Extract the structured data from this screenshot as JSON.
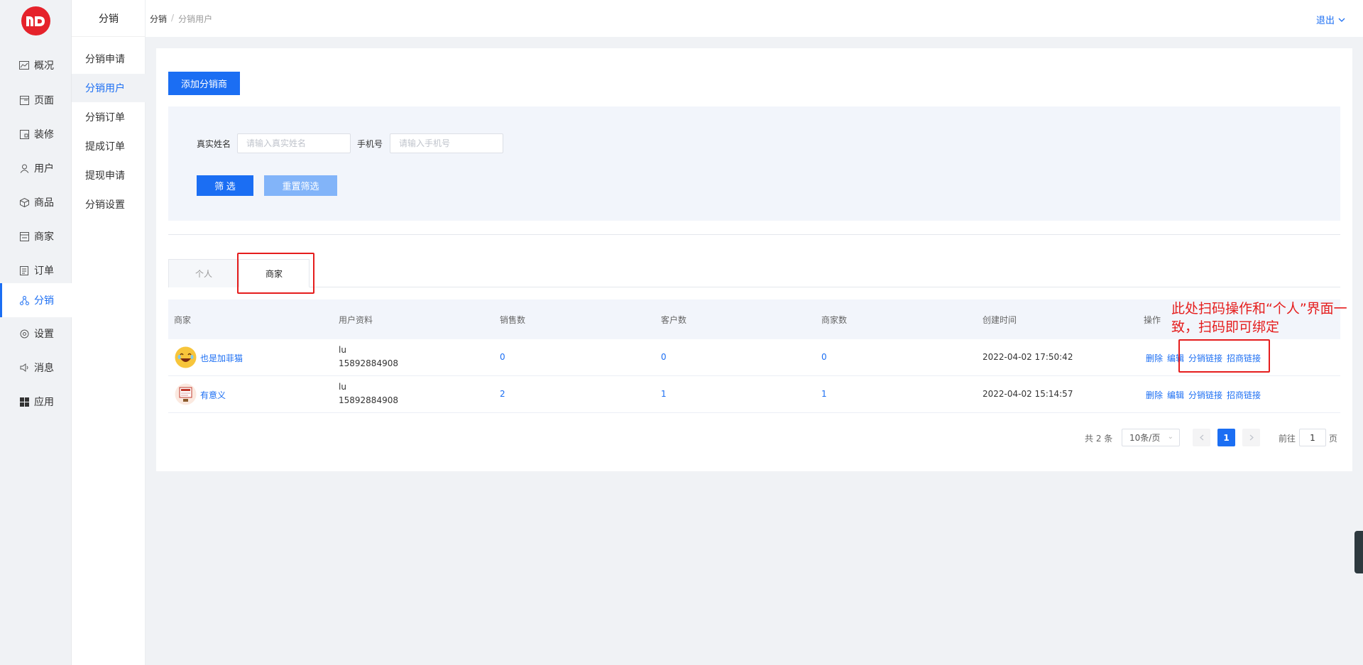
{
  "rail": {
    "items": [
      {
        "label": "概况",
        "icon": "line-chart-icon"
      },
      {
        "label": "页面",
        "icon": "page-icon"
      },
      {
        "label": "装修",
        "icon": "decorate-icon"
      },
      {
        "label": "用户",
        "icon": "user-icon"
      },
      {
        "label": "商品",
        "icon": "box-icon"
      },
      {
        "label": "商家",
        "icon": "store-icon"
      },
      {
        "label": "订单",
        "icon": "order-icon"
      },
      {
        "label": "分销",
        "icon": "distribution-icon",
        "active": true
      },
      {
        "label": "设置",
        "icon": "settings-icon"
      },
      {
        "label": "消息",
        "icon": "message-icon"
      },
      {
        "label": "应用",
        "icon": "apps-icon"
      }
    ]
  },
  "submenu": {
    "title": "分销",
    "items": [
      "分销申请",
      "分销用户",
      "分销订单",
      "提成订单",
      "提现申请",
      "分销设置"
    ]
  },
  "header": {
    "breadcrumb": [
      "分销",
      "分销用户"
    ],
    "logout": "退出"
  },
  "toolbar": {
    "add_label": "添加分销商"
  },
  "filter": {
    "name_label": "真实姓名",
    "name_placeholder": "请输入真实姓名",
    "phone_label": "手机号",
    "phone_placeholder": "请输入手机号",
    "filter_button": "筛 选",
    "reset_button": "重置筛选"
  },
  "tabs": [
    "个人",
    "商家"
  ],
  "table": {
    "columns": [
      "商家",
      "用户资料",
      "销售数",
      "客户数",
      "商家数",
      "创建时间",
      "操作"
    ],
    "rows": [
      {
        "merchant": "也是加菲猫",
        "user_name": "lu",
        "user_phone": "15892884908",
        "sales": "0",
        "customers": "0",
        "merchants": "0",
        "created": "2022-04-02 17:50:42"
      },
      {
        "merchant": "有意义",
        "user_name": "lu",
        "user_phone": "15892884908",
        "sales": "2",
        "customers": "1",
        "merchants": "1",
        "created": "2022-04-02 15:14:57"
      }
    ],
    "ops": [
      "删除",
      "编辑",
      "分销链接",
      "招商链接"
    ]
  },
  "pagination": {
    "total": "共 2 条",
    "page_size": "10条/页",
    "current": "1",
    "goto_label": "前往",
    "goto_value": "1",
    "page_suffix": "页"
  },
  "annotation": {
    "note": "此处扫码操作和“个人”界面一致，扫码即可绑定"
  },
  "colors": {
    "primary": "#1b6ef3",
    "annotation_red": "#e51d1d",
    "logo_red": "#e5222b"
  }
}
